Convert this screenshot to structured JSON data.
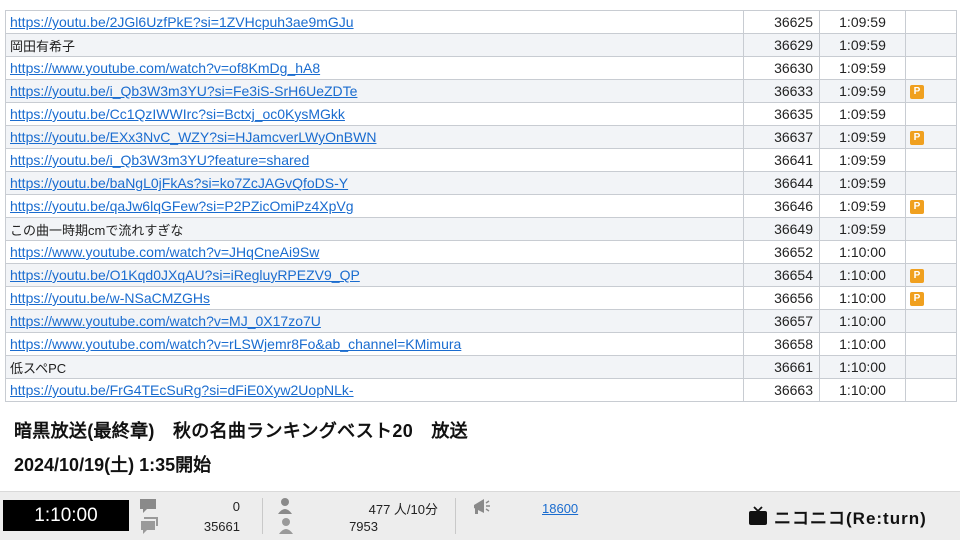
{
  "comments": [
    {
      "text": "https://youtu.be/2JGl6UzfPkE?si=1ZVHcpuh3ae9mGJu",
      "link": true,
      "no": "36625",
      "time": "1:09:59",
      "premium": false
    },
    {
      "text": "岡田有希子",
      "link": false,
      "no": "36629",
      "time": "1:09:59",
      "premium": false
    },
    {
      "text": "https://www.youtube.com/watch?v=of8KmDg_hA8",
      "link": true,
      "no": "36630",
      "time": "1:09:59",
      "premium": false
    },
    {
      "text": "https://youtu.be/i_Qb3W3m3YU?si=Fe3iS-SrH6UeZDTe",
      "link": true,
      "no": "36633",
      "time": "1:09:59",
      "premium": true
    },
    {
      "text": "https://youtu.be/Cc1QzIWWIrc?si=Bctxj_oc0KysMGkk",
      "link": true,
      "no": "36635",
      "time": "1:09:59",
      "premium": false
    },
    {
      "text": "https://youtu.be/EXx3NvC_WZY?si=HJamcverLWyOnBWN",
      "link": true,
      "no": "36637",
      "time": "1:09:59",
      "premium": true
    },
    {
      "text": "https://youtu.be/i_Qb3W3m3YU?feature=shared",
      "link": true,
      "no": "36641",
      "time": "1:09:59",
      "premium": false
    },
    {
      "text": "https://youtu.be/baNgL0jFkAs?si=ko7ZcJAGvQfoDS-Y",
      "link": true,
      "no": "36644",
      "time": "1:09:59",
      "premium": false
    },
    {
      "text": "https://youtu.be/qaJw6lqGFew?si=P2PZicOmiPz4XpVg",
      "link": true,
      "no": "36646",
      "time": "1:09:59",
      "premium": true
    },
    {
      "text": "この曲一時期cmで流れすぎな",
      "link": false,
      "no": "36649",
      "time": "1:09:59",
      "premium": false
    },
    {
      "text": "https://www.youtube.com/watch?v=JHqCneAi9Sw",
      "link": true,
      "no": "36652",
      "time": "1:10:00",
      "premium": false
    },
    {
      "text": "https://youtu.be/O1Kqd0JXqAU?si=iRegluyRPEZV9_QP",
      "link": true,
      "no": "36654",
      "time": "1:10:00",
      "premium": true
    },
    {
      "text": "https://youtu.be/w-NSaCMZGHs",
      "link": true,
      "no": "36656",
      "time": "1:10:00",
      "premium": true
    },
    {
      "text": "https://www.youtube.com/watch?v=MJ_0X17zo7U",
      "link": true,
      "no": "36657",
      "time": "1:10:00",
      "premium": false
    },
    {
      "text": "https://www.youtube.com/watch?v=rLSWjemr8Fo&ab_channel=KMimura",
      "link": true,
      "no": "36658",
      "time": "1:10:00",
      "premium": false
    },
    {
      "text": "低スペPC",
      "link": false,
      "no": "36661",
      "time": "1:10:00",
      "premium": false
    },
    {
      "text": "https://youtu.be/FrG4TEcSuRg?si=dFiE0Xyw2UopNLk-",
      "link": true,
      "no": "36663",
      "time": "1:10:00",
      "premium": false
    }
  ],
  "premium_badge": "P",
  "program": {
    "title": "暗黒放送(最終章)　秋の名曲ランキングベスト20　放送",
    "date": "2024/10/19(土) 1:35開始"
  },
  "status": {
    "elapsed": "1:10:00",
    "comment_count_top": "0",
    "comment_count_bottom": "35661",
    "viewers_rate": "477 人/10分",
    "viewers_total": "7953",
    "ad_points": "18600"
  },
  "logo": {
    "text": "ニコニコ(Re:turn)"
  },
  "colors": {
    "link": "#1a6ccf",
    "premium_badge": "#f0a01f",
    "clock_bg": "#000000"
  }
}
